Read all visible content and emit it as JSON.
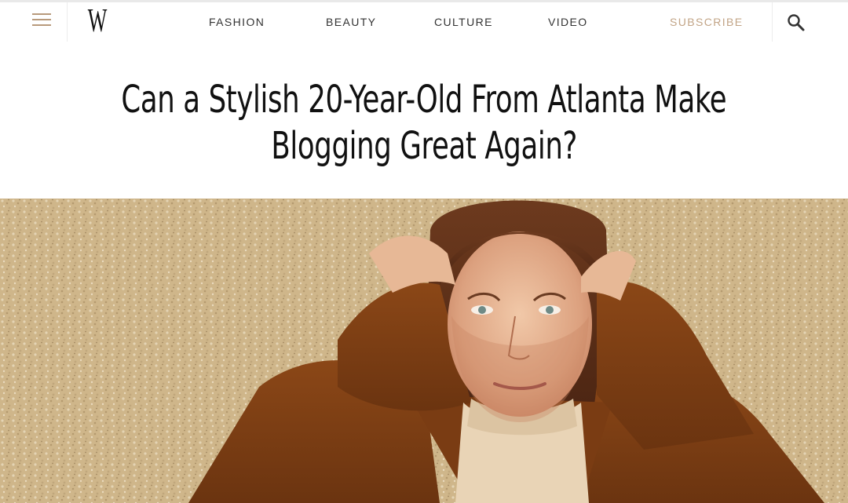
{
  "header": {
    "logo": "W",
    "nav": [
      "FASHION",
      "BEAUTY",
      "CULTURE",
      "VIDEO"
    ],
    "subscribe_label": "SUBSCRIBE"
  },
  "icons": {
    "menu": "hamburger-menu-icon",
    "search": "search-icon"
  },
  "article": {
    "headline_line1": "Can a Stylish 20-Year-Old From Atlanta Make",
    "headline_line2": "Blogging Great Again?"
  },
  "colors": {
    "accent": "#c2a486",
    "menu_icon": "#b89a7c",
    "text": "#111111",
    "coat": "#7a3e12",
    "wall": "#cfb68c"
  }
}
